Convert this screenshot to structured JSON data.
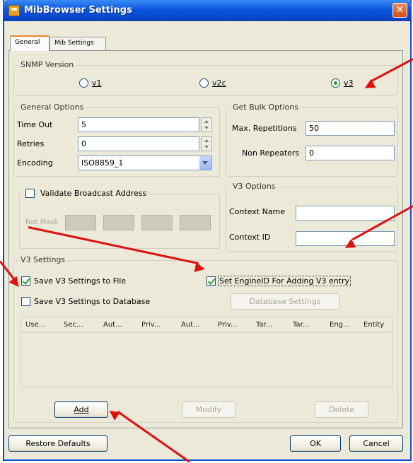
{
  "window": {
    "title": "MibBrowser Settings",
    "close_label": "✕"
  },
  "tabs": [
    {
      "label": "General",
      "active": true
    },
    {
      "label": "Mib Settings",
      "active": false
    }
  ],
  "snmp_version": {
    "legend": "SNMP Version",
    "options": [
      {
        "label": "v1",
        "checked": false
      },
      {
        "label": "v2c",
        "checked": false
      },
      {
        "label": "v3",
        "checked": true
      }
    ]
  },
  "general_options": {
    "legend": "General Options",
    "time_out_label": "Time Out",
    "time_out_value": "5",
    "retries_label": "Retries",
    "retries_value": "0",
    "encoding_label": "Encoding",
    "encoding_value": "ISO8859_1"
  },
  "get_bulk": {
    "legend": "Get Bulk Options",
    "max_rep_label": "Max. Repetitions",
    "max_rep_value": "50",
    "non_rep_label": "Non Repeaters",
    "non_rep_value": "0"
  },
  "broadcast": {
    "label": "Validate Broadcast Address",
    "checked": false,
    "netmask_label": "Net Mask"
  },
  "v3_options": {
    "legend": "V3 Options",
    "context_name_label": "Context Name",
    "context_name_value": "",
    "context_id_label": "Context ID",
    "context_id_value": ""
  },
  "v3_settings": {
    "legend": "V3 Settings",
    "save_file_label": "Save V3 Settings to File",
    "save_file_checked": true,
    "save_db_label": "Save V3 Settings to Database",
    "save_db_checked": false,
    "engineid_label": "Set EngineID For Adding V3 entry",
    "engineid_checked": true,
    "database_settings_label": "Database Settings",
    "columns": [
      "Use...",
      "Sec...",
      "Aut...",
      "Priv...",
      "Aut...",
      "Priv...",
      "Tar...",
      "Tar...",
      "Eng...",
      "Entity"
    ],
    "add_label": "Add",
    "modify_label": "Modify",
    "delete_label": "Delete"
  },
  "footer": {
    "restore_label": "Restore Defaults",
    "ok_label": "OK",
    "cancel_label": "Cancel"
  },
  "colors": {
    "annotation_arrow": "#e01010",
    "titlebar": "#0a55e0",
    "dialog_bg": "#ece9d8"
  }
}
